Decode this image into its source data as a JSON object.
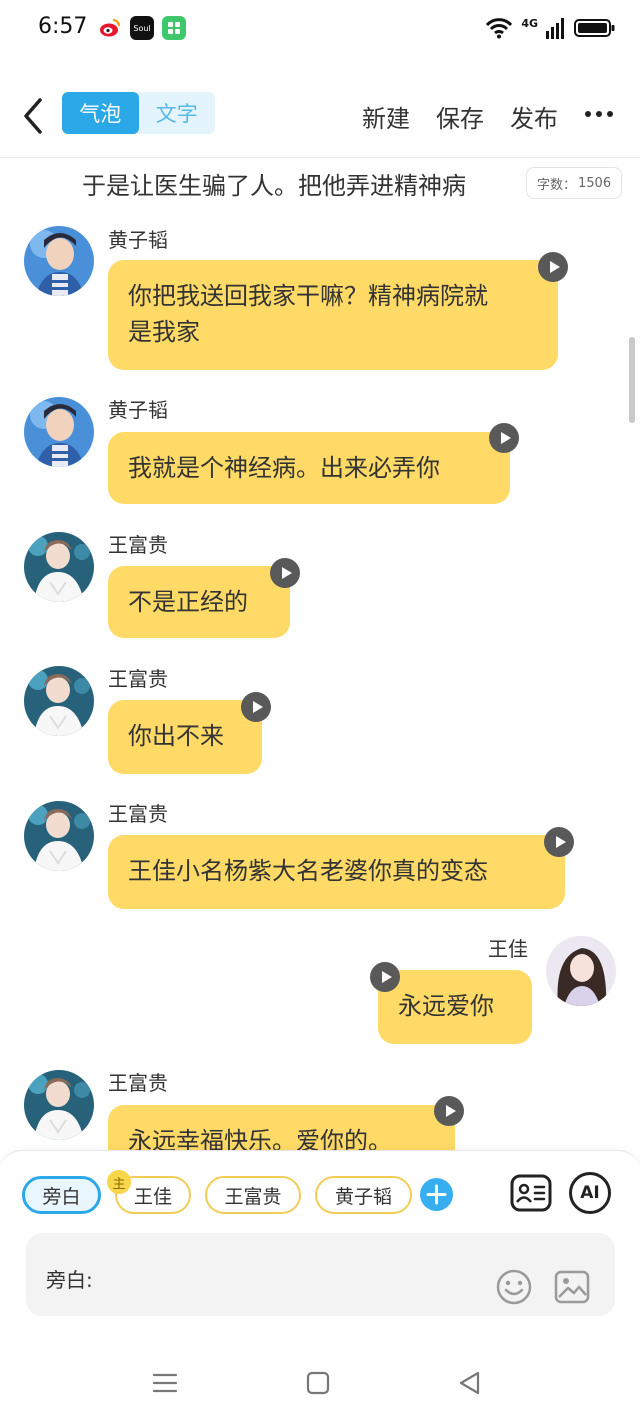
{
  "status_bar": {
    "time": "6:57",
    "network": "4G",
    "app_icons": [
      "weibo-icon",
      "soul-icon",
      "wechat-work-icon"
    ]
  },
  "header": {
    "mode_tabs": [
      {
        "label": "气泡",
        "active": true
      },
      {
        "label": "文字",
        "active": false
      }
    ],
    "actions": {
      "new": "新建",
      "save": "保存",
      "publish": "发布"
    }
  },
  "narration": {
    "text": "于是让医生骗了人。把他弄进精神病",
    "word_count_label": "字数：",
    "word_count": "1506"
  },
  "messages": [
    {
      "sender": "黄子韬",
      "side": "left",
      "text": "你把我送回我家干嘛？精神病院就是我家",
      "line1": "你把我送回我家干嘛？精神病院就",
      "line2": "是我家"
    },
    {
      "sender": "黄子韬",
      "side": "left",
      "text": "我就是个神经病。出来必弄你"
    },
    {
      "sender": "王富贵",
      "side": "left",
      "text": "不是正经的"
    },
    {
      "sender": "王富贵",
      "side": "left",
      "text": "你出不来"
    },
    {
      "sender": "王富贵",
      "side": "left",
      "text": "王佳小名杨紫大名老婆你真的变态"
    },
    {
      "sender": "王佳",
      "side": "right",
      "text": "永远爱你"
    },
    {
      "sender": "王富贵",
      "side": "left",
      "text": "永远幸福快乐。爱你的。"
    }
  ],
  "roles": {
    "items": [
      {
        "label": "旁白",
        "selected": true
      },
      {
        "label": "王佳",
        "selected": false,
        "tag": "主"
      },
      {
        "label": "王富贵",
        "selected": false
      },
      {
        "label": "黄子韬",
        "selected": false
      }
    ]
  },
  "input": {
    "prefix": "旁白:",
    "ai_label": "AI"
  },
  "colors": {
    "accent": "#2ba8e8",
    "bubble": "#ffda66",
    "chip_border": "#f2cc55"
  }
}
